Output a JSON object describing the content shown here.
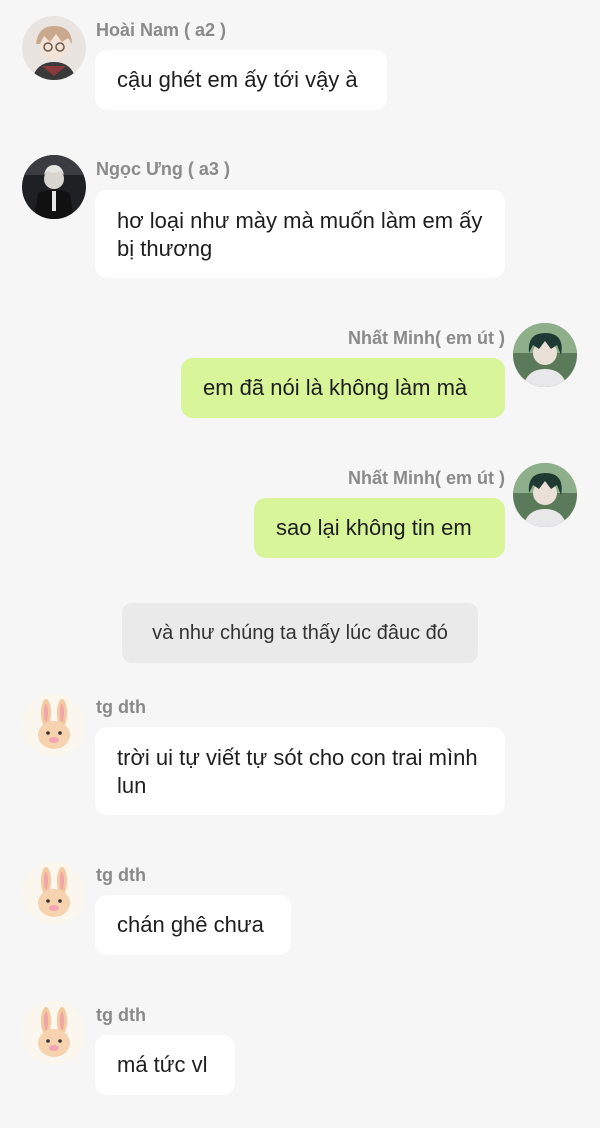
{
  "messages": [
    {
      "name": "Hoài Nam ( a2 )",
      "text": "cậu ghét em ấy tới vậy à",
      "avatar": "boy-glasses-avatar"
    },
    {
      "name": "Ngọc Ưng ( a3 )",
      "text": "hơ loại như mày mà muốn làm em ấy bị thương",
      "avatar": "dark-suit-avatar"
    },
    {
      "name": "Nhất Minh( em út )",
      "text": "em đã nói là không làm mà",
      "avatar": "teal-hair-boy-avatar"
    },
    {
      "name": "Nhất Minh( em út )",
      "text": "sao lại không tin em",
      "avatar": "teal-hair-boy-avatar"
    },
    {
      "narration": "và như chúng ta thấy lúc đâuc đó"
    },
    {
      "name": "tg dth",
      "text": "trời ui tự viết tự sót cho con trai mình lun",
      "avatar": "bunny-avatar"
    },
    {
      "name": "tg dth",
      "text": "chán ghê chưa",
      "avatar": "bunny-avatar"
    },
    {
      "name": "tg dth",
      "text": "má tức vl",
      "avatar": "bunny-avatar"
    }
  ],
  "colors": {
    "background": "#f6f6f6",
    "incoming_bubble": "#ffffff",
    "outgoing_bubble": "#d8f59a",
    "narration_bubble": "#eaeaea",
    "name_text": "#8a8a8a"
  }
}
